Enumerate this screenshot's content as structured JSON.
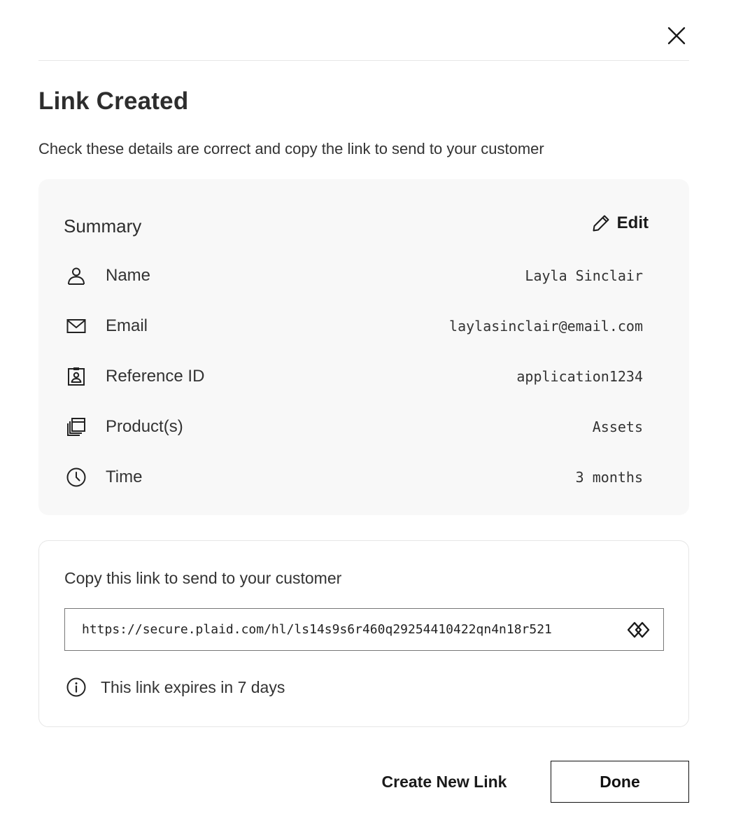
{
  "header": {
    "close_icon": "close-icon",
    "title": "Link Created",
    "subtitle": "Check these details are correct and copy the link to send to your customer"
  },
  "summary": {
    "title": "Summary",
    "edit_label": "Edit",
    "edit_icon": "pencil-icon",
    "rows": [
      {
        "icon": "person-icon",
        "label": "Name",
        "value": "Layla Sinclair"
      },
      {
        "icon": "mail-icon",
        "label": "Email",
        "value": "laylasinclair@email.com"
      },
      {
        "icon": "id-badge-icon",
        "label": "Reference ID",
        "value": "application1234"
      },
      {
        "icon": "stacked-pages-icon",
        "label": "Product(s)",
        "value": "Assets"
      },
      {
        "icon": "clock-icon",
        "label": "Time",
        "value": "3 months"
      }
    ]
  },
  "link": {
    "heading": "Copy this link to send to your customer",
    "url": "https://secure.plaid.com/hl/ls14s9s6r460q29254410422qn4n18r521",
    "copy_icon": "copy-icon",
    "expiry_icon": "info-icon",
    "expiry_text": "This link expires in 7 days"
  },
  "actions": {
    "create_new_label": "Create New Link",
    "done_label": "Done"
  }
}
